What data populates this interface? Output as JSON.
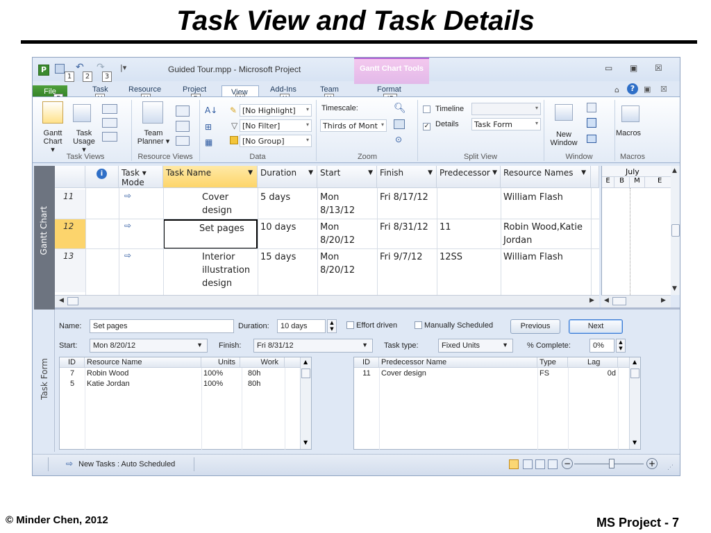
{
  "slide": {
    "title": "Task View and Task Details",
    "footer_left": "© Minder Chen, 2012",
    "footer_right": "MS Project - 7"
  },
  "window": {
    "title": "Guided Tour.mpp  -  Microsoft Project",
    "context_tab": "Gantt Chart Tools",
    "qat_keytips": [
      "1",
      "2",
      "3"
    ],
    "controls": {
      "minimize": "▭",
      "restore": "▣",
      "close": "☒"
    }
  },
  "tabs": [
    {
      "label": "File",
      "keytip": "F"
    },
    {
      "label": "Task",
      "keytip": "H"
    },
    {
      "label": "Resource",
      "keytip": "U"
    },
    {
      "label": "Project",
      "keytip": "R"
    },
    {
      "label": "View",
      "keytip": "W"
    },
    {
      "label": "Add-Ins",
      "keytip": "X"
    },
    {
      "label": "Team",
      "keytip": "Y"
    },
    {
      "label": "Format",
      "keytip": "JF"
    }
  ],
  "ribbon": {
    "task_views": {
      "label": "Task Views",
      "gantt_line1": "Gantt",
      "gantt_line2": "Chart",
      "usage_line1": "Task",
      "usage_line2": "Usage"
    },
    "resource_views": {
      "label": "Resource Views",
      "planner_line1": "Team",
      "planner_line2": "Planner"
    },
    "data": {
      "label": "Data",
      "highlight": "[No Highlight]",
      "filter": "[No Filter]",
      "group": "[No Group]"
    },
    "zoom": {
      "label": "Zoom",
      "timescale_label": "Timescale:",
      "timescale_value": "Thirds of Mont"
    },
    "split_view": {
      "label": "Split View",
      "timeline_label": "Timeline",
      "details_label": "Details",
      "details_value": "Task Form"
    },
    "window": {
      "label": "Window",
      "new_line1": "New",
      "new_line2": "Window"
    },
    "macros": {
      "label": "Macros",
      "button": "Macros"
    }
  },
  "gantt": {
    "sidebar_label": "Gantt Chart",
    "columns": {
      "mode_line1": "Task",
      "mode_line2": "Mode",
      "name": "Task Name",
      "duration": "Duration",
      "start": "Start",
      "finish": "Finish",
      "predecessors": "Predecessor",
      "resources": "Resource Names"
    },
    "timeline_month": "July",
    "timeline_days": [
      "E",
      "B",
      "M",
      "E"
    ],
    "rows": [
      {
        "id": "11",
        "name1": "Cover",
        "name2": "design",
        "name3": "",
        "duration": "5 days",
        "start1": "Mon",
        "start2": "8/13/12",
        "finish": "Fri 8/17/12",
        "pred": "",
        "res1": "William Flash",
        "res2": ""
      },
      {
        "id": "12",
        "name1": "Set pages",
        "name2": "",
        "name3": "",
        "duration": "10 days",
        "start1": "Mon",
        "start2": "8/20/12",
        "finish": "Fri 8/31/12",
        "pred": "11",
        "res1": "Robin Wood,Katie",
        "res2": "Jordan"
      },
      {
        "id": "13",
        "name1": "Interior",
        "name2": "illustration",
        "name3": "design",
        "duration": "15 days",
        "start1": "Mon",
        "start2": "8/20/12",
        "finish": "Fri 9/7/12",
        "pred": "12SS",
        "res1": "William Flash",
        "res2": ""
      }
    ]
  },
  "task_form": {
    "sidebar_label": "Task Form",
    "name_label": "Name:",
    "name_value": "Set pages",
    "duration_label": "Duration:",
    "duration_value": "10 days",
    "effort_label": "Effort driven",
    "manual_label": "Manually Scheduled",
    "previous": "Previous",
    "next": "Next",
    "start_label": "Start:",
    "start_value": "Mon 8/20/12",
    "finish_label": "Finish:",
    "finish_value": "Fri 8/31/12",
    "task_type_label": "Task type:",
    "task_type_value": "Fixed Units",
    "complete_label": "% Complete:",
    "complete_value": "0%",
    "res_headers": {
      "id": "ID",
      "name": "Resource Name",
      "units": "Units",
      "work": "Work"
    },
    "resources": [
      {
        "id": "7",
        "name": "Robin Wood",
        "units": "100%",
        "work": "80h"
      },
      {
        "id": "5",
        "name": "Katie Jordan",
        "units": "100%",
        "work": "80h"
      }
    ],
    "pred_headers": {
      "id": "ID",
      "name": "Predecessor Name",
      "type": "Type",
      "lag": "Lag"
    },
    "predecessors": [
      {
        "id": "11",
        "name": "Cover design",
        "type": "FS",
        "lag": "0d"
      }
    ]
  },
  "status_bar": {
    "mode": "New Tasks : Auto Scheduled"
  }
}
